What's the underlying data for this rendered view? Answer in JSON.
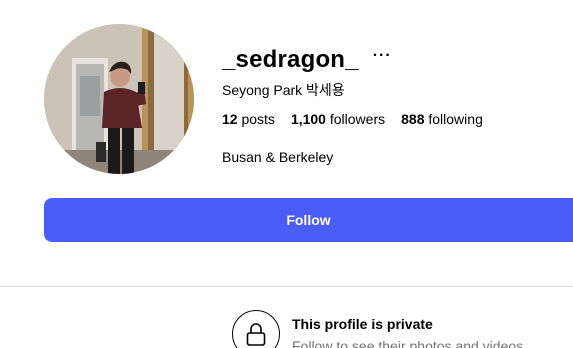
{
  "profile": {
    "username": "_sedragon_",
    "more_label": "···",
    "full_name": "Seyong Park 박세용",
    "bio": "Busan & Berkeley",
    "avatar_alt": "profile-photo"
  },
  "stats": {
    "posts_count": "12",
    "posts_label": "posts",
    "followers_count": "1,100",
    "followers_label": "followers",
    "following_count": "888",
    "following_label": "following"
  },
  "actions": {
    "follow_label": "Follow"
  },
  "private_notice": {
    "title": "This profile is private",
    "subtitle": "Follow to see their photos and videos."
  },
  "icons": {
    "lock": "lock-icon",
    "more": "more-options-icon"
  },
  "colors": {
    "accent": "#4a5df9",
    "divider": "#dbdbdb",
    "secondary_text": "#737373"
  }
}
